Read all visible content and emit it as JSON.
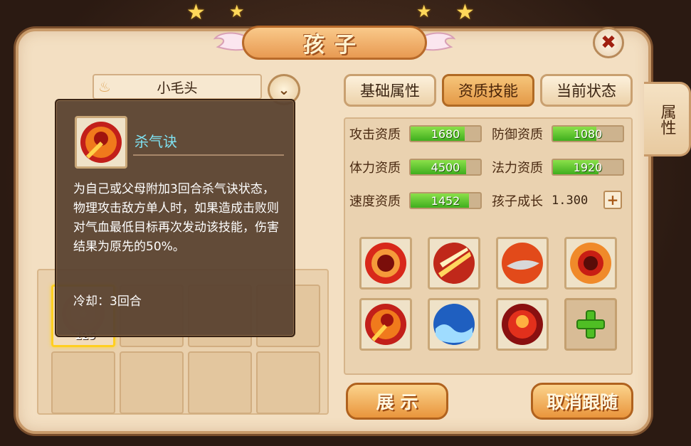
{
  "window": {
    "title": "孩子"
  },
  "close": {
    "icon": "close-icon"
  },
  "side_tab": {
    "label": "属性"
  },
  "child": {
    "name": "小毛头"
  },
  "tabs": [
    {
      "label": "基础属性",
      "selected": false
    },
    {
      "label": "资质技能",
      "selected": true
    },
    {
      "label": "当前状态",
      "selected": false
    }
  ],
  "tooltip": {
    "skill_name": "杀气诀",
    "description": "为自己或父母附加3回合杀气诀状态，物理攻击敌方单人时，如果造成击败则对气血最低目标再次发动该技能，伤害结果为原先的50%。",
    "cooldown": "冷却：3回合"
  },
  "slots": {
    "active_level": "125"
  },
  "attributes": {
    "attack": {
      "label": "攻击资质",
      "value": "1680",
      "fill": 0.78
    },
    "defense": {
      "label": "防御资质",
      "value": "1080",
      "fill": 0.62
    },
    "hp": {
      "label": "体力资质",
      "value": "4500",
      "fill": 0.8
    },
    "magic": {
      "label": "法力资质",
      "value": "1920",
      "fill": 0.65
    },
    "speed": {
      "label": "速度资质",
      "value": "1452",
      "fill": 0.84
    },
    "growth": {
      "label": "孩子成长",
      "value": "1.300"
    }
  },
  "skills": [
    "demon-face-skill-icon",
    "blade-slash-skill-icon",
    "fire-blade-skill-icon",
    "demon-face-fire-skill-icon",
    "killing-aura-skill-icon",
    "wave-skill-icon",
    "fire-demon-skill-icon",
    "add-skill-icon"
  ],
  "buttons": {
    "show": "展 示",
    "unfollow": "取消跟随"
  },
  "colors": {
    "panel": "#f3dfc2",
    "tab_selected": "#e49a48",
    "bar_fill": "#3fae1e",
    "tooltip_bg": "#5a4230",
    "skill_name": "#7fe2f2"
  }
}
